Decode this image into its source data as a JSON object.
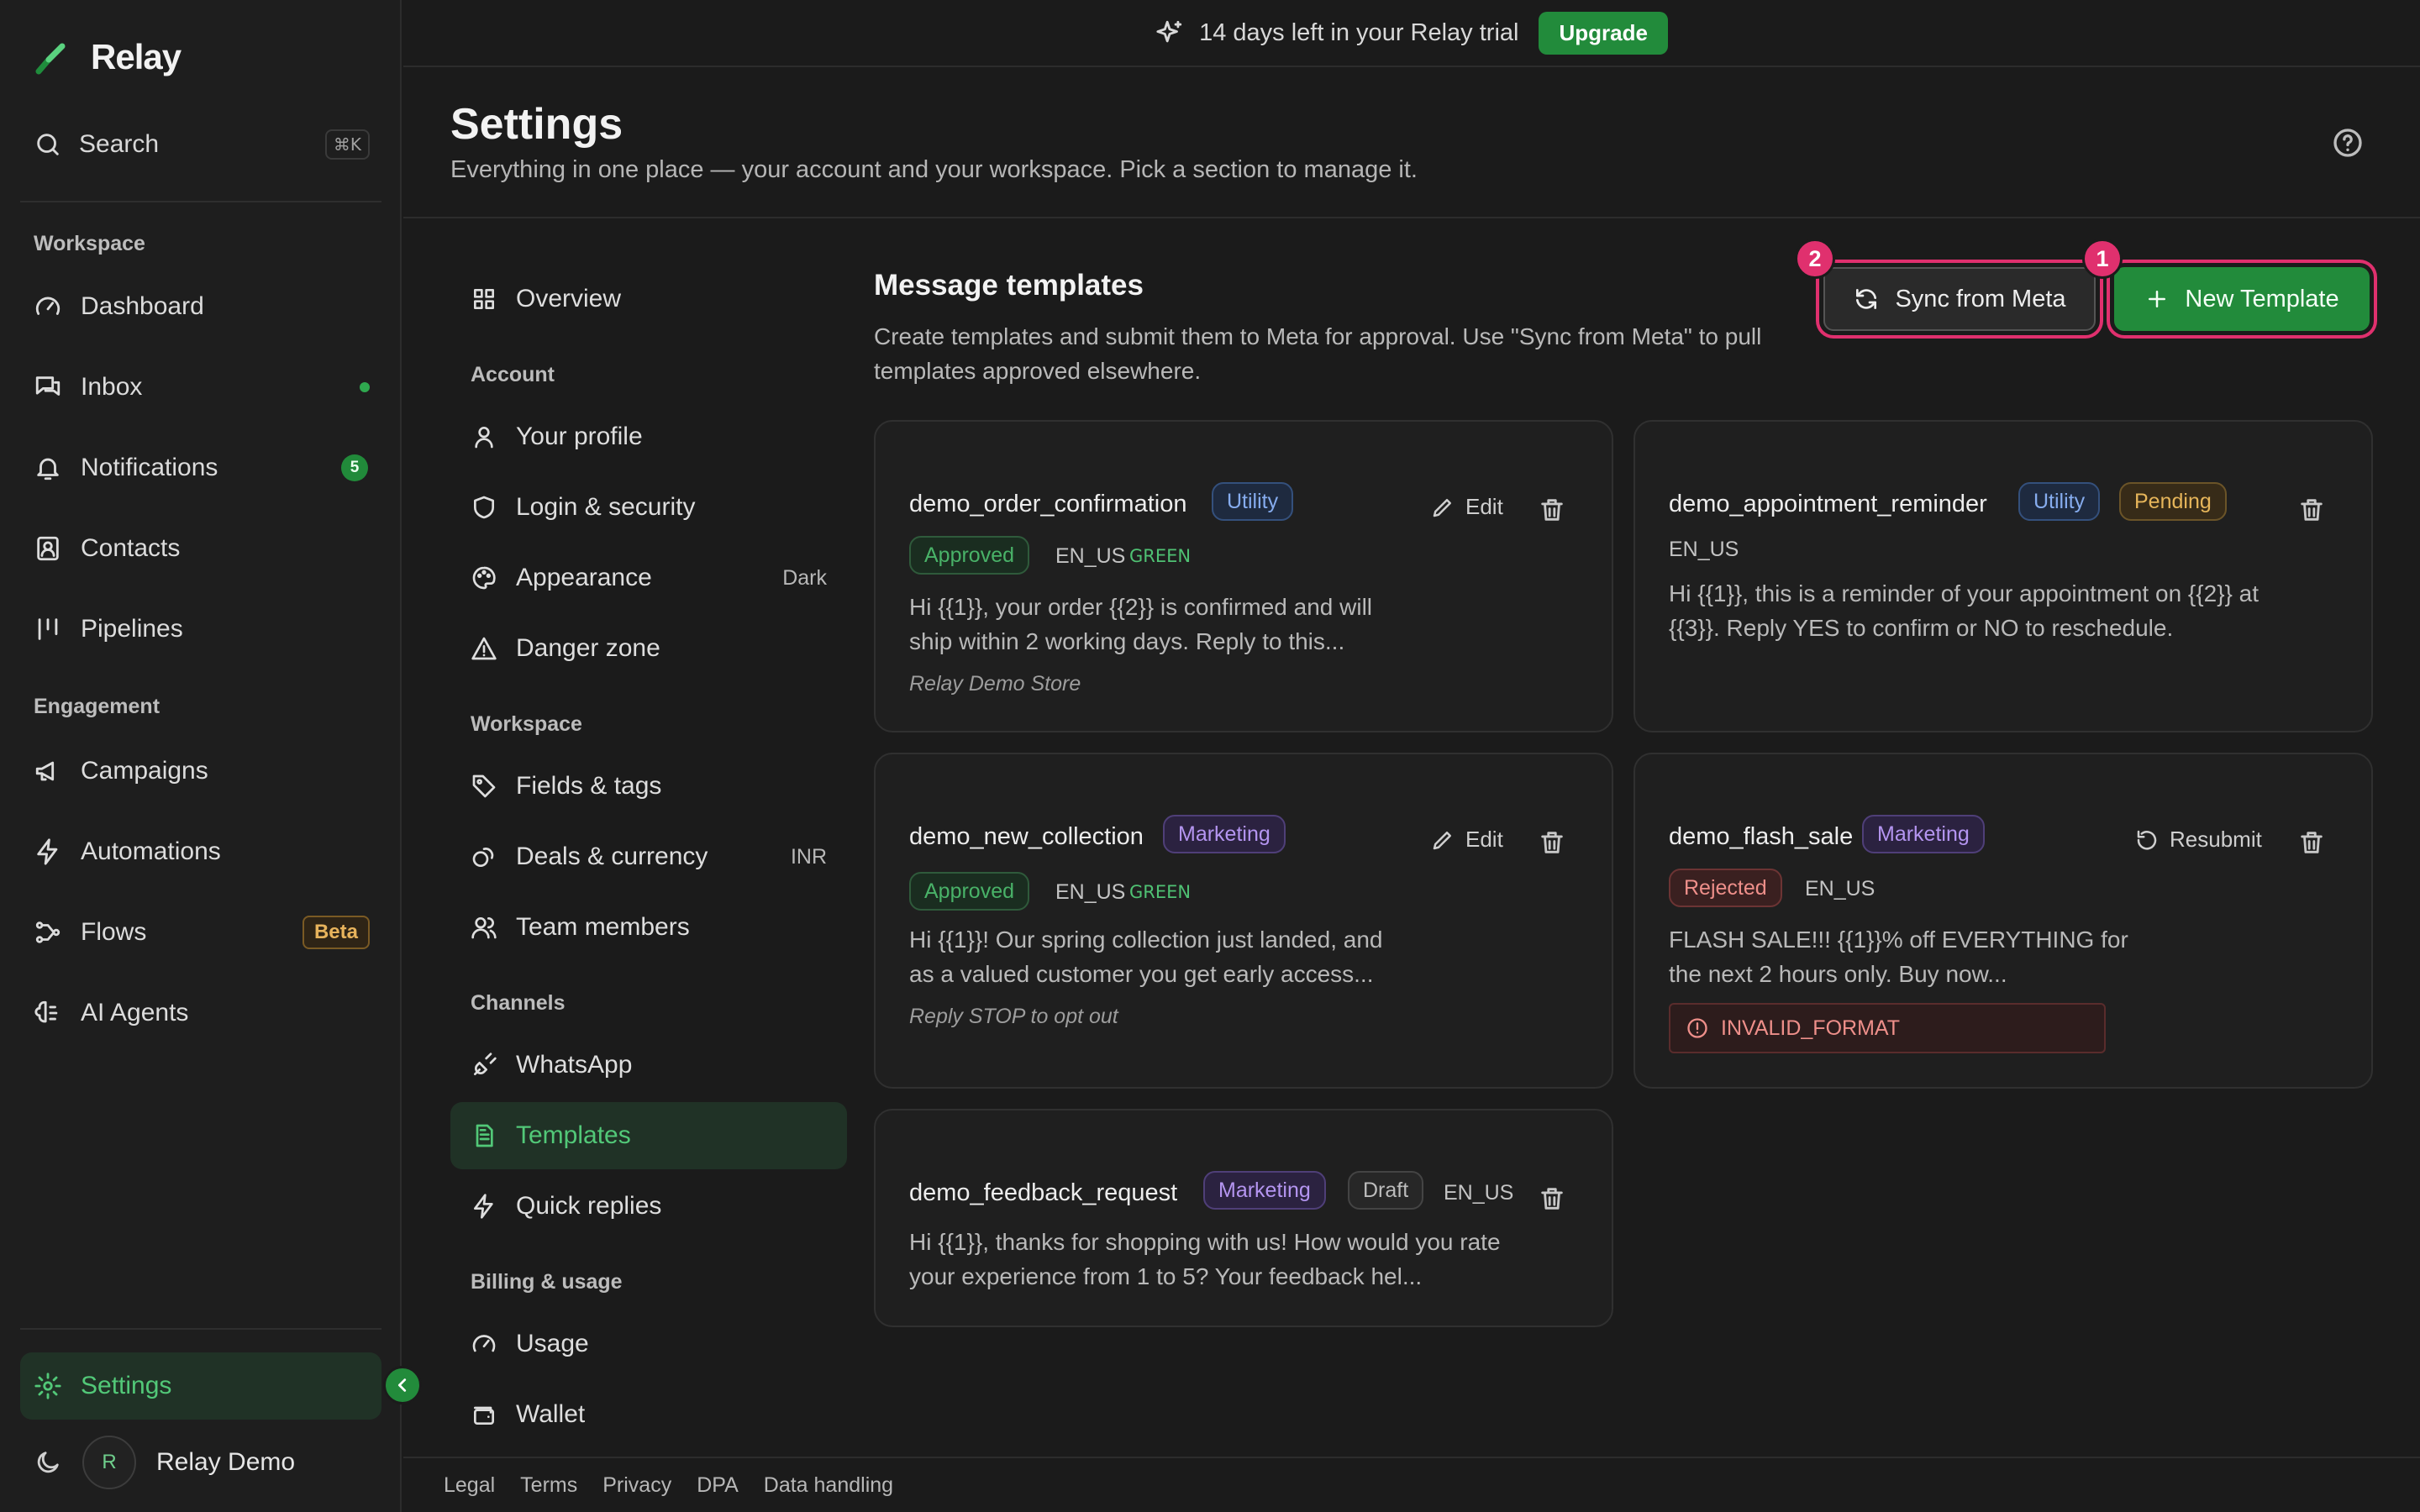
{
  "app": {
    "name": "Relay"
  },
  "sidebar": {
    "search_label": "Search",
    "search_shortcut": "⌘K",
    "sections": {
      "workspace": "Workspace",
      "engagement": "Engagement"
    },
    "items": {
      "dashboard": "Dashboard",
      "inbox": "Inbox",
      "notifications": "Notifications",
      "notifications_count": "5",
      "contacts": "Contacts",
      "pipelines": "Pipelines",
      "campaigns": "Campaigns",
      "automations": "Automations",
      "flows": "Flows",
      "flows_badge": "Beta",
      "ai_agents": "AI Agents",
      "settings": "Settings"
    },
    "user": {
      "initial": "R",
      "name": "Relay Demo"
    }
  },
  "banner": {
    "text": "14 days left in your Relay trial",
    "upgrade_label": "Upgrade"
  },
  "header": {
    "title": "Settings",
    "subtitle": "Everything in one place — your account and your workspace. Pick a section to manage it."
  },
  "settings_nav": {
    "overview": "Overview",
    "sections": {
      "account": "Account",
      "workspace": "Workspace",
      "channels": "Channels",
      "billing": "Billing & usage"
    },
    "items": {
      "your_profile": "Your profile",
      "login_security": "Login & security",
      "appearance": "Appearance",
      "appearance_value": "Dark",
      "danger_zone": "Danger zone",
      "fields_tags": "Fields & tags",
      "deals_currency": "Deals & currency",
      "deals_currency_value": "INR",
      "team_members": "Team members",
      "whatsapp": "WhatsApp",
      "templates": "Templates",
      "quick_replies": "Quick replies",
      "usage": "Usage",
      "wallet": "Wallet"
    }
  },
  "main": {
    "title": "Message templates",
    "description": "Create templates and submit them to Meta for approval. Use \"Sync from Meta\" to pull templates approved elsewhere.",
    "sync_label": "Sync from Meta",
    "new_label": "New Template",
    "markers": {
      "sync": "2",
      "new": "1"
    },
    "templates": [
      {
        "name": "demo_order_confirmation",
        "category": "Utility",
        "status": "Approved",
        "language": "EN_US",
        "quality": "GREEN",
        "body": "Hi {{1}}, your order {{2}} is confirmed and will ship within 2 working days. Reply to this...",
        "footer": "Relay Demo Store",
        "action": "Edit"
      },
      {
        "name": "demo_appointment_reminder",
        "category": "Utility",
        "status": "Pending",
        "language": "EN_US",
        "body": "Hi {{1}}, this is a reminder of your appointment on {{2}} at {{3}}. Reply YES to confirm or NO to reschedule."
      },
      {
        "name": "demo_new_collection",
        "category": "Marketing",
        "status": "Approved",
        "language": "EN_US",
        "quality": "GREEN",
        "body": "Hi {{1}}! Our spring collection just landed, and as a valued customer you get early access...",
        "footer": "Reply STOP to opt out",
        "action": "Edit"
      },
      {
        "name": "demo_flash_sale",
        "category": "Marketing",
        "status": "Rejected",
        "language": "EN_US",
        "body": "FLASH SALE!!! {{1}}% off EVERYTHING for the next 2 hours only. Buy now...",
        "error": "INVALID_FORMAT",
        "action": "Resubmit"
      },
      {
        "name": "demo_feedback_request",
        "category": "Marketing",
        "status": "Draft",
        "language": "EN_US",
        "body": "Hi {{1}}, thanks for shopping with us! How would you rate your experience from 1 to 5? Your feedback hel..."
      }
    ]
  },
  "footer": {
    "links": [
      "Legal",
      "Terms",
      "Privacy",
      "DPA",
      "Data handling"
    ]
  },
  "colors": {
    "accent": "#228b3b",
    "highlight": "#e0306e",
    "background": "#1b1b1b"
  }
}
